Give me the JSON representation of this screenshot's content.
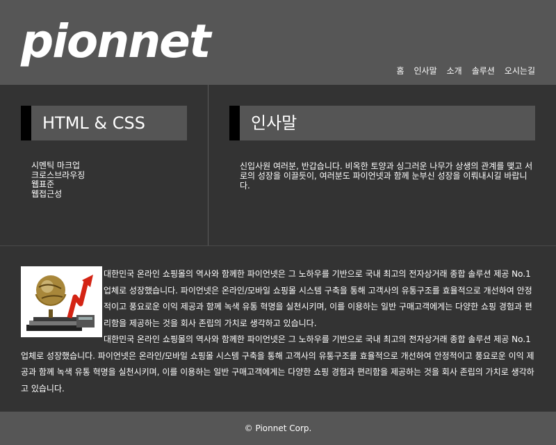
{
  "header": {
    "logo": "pionnet",
    "nav": [
      "홈",
      "인사말",
      "소개",
      "솔루션",
      "오시는길"
    ]
  },
  "left": {
    "title": "HTML & CSS",
    "items": [
      "시멘틱 마크업",
      "크로스브라우징",
      "웹표준",
      "웹접근성"
    ]
  },
  "right": {
    "title": "인사말",
    "text": "신입사원 여러분, 반갑습니다. 비옥한 토양과 싱그러운 나무가 상생의 관계를 맺고 서로의 성장을 이끌듯이, 여러분도 파이언넷과 함께 눈부신 성장을 이뤄내시길 바랍니다."
  },
  "content": {
    "image_icon": "globe-arrow-graph-icon",
    "paragraph_1": "대한민국 온라인 쇼핑몰의 역사와 함께한 파이언넷은 그 노하우를 기반으로 국내 최고의 전자상거래 종합 솔루션 제공 No.1 업체로 성장했습니다. 파이언넷은 온라인/모바일 쇼핑몰 시스템 구축을 통해 고객사의 유통구조를 효율적으로 개선하여 안정적이고 풍요로운 이익 제공과 함께 녹색 유통 혁명을 실천시키며, 이를 이용하는 일반 구매고객에게는 다양한 쇼핑 경험과 편리함을 제공하는 것을 회사 존립의 가치로 생각하고 있습니다.",
    "paragraph_2": "대한민국 온라인 쇼핑몰의 역사와 함께한 파이언넷은 그 노하우를 기반으로 국내 최고의 전자상거래 종합 솔루션 제공 No.1 업체로 성장했습니다. 파이언넷은 온라인/모바일 쇼핑몰 시스템 구축을 통해 고객사의 유통구조를 효율적으로 개선하여 안정적이고 풍요로운 이익 제공과 함께 녹색 유통 혁명을 실천시키며, 이를 이용하는 일반 구매고객에게는 다양한 쇼핑 경험과 편리함을 제공하는 것을 회사 존립의 가치로 생각하고 있습니다."
  },
  "footer": {
    "copyright": "© Pionnet Corp."
  },
  "colors": {
    "header_bg": "#565656",
    "body_bg": "#333333",
    "title_bg": "#555555",
    "title_bar": "#000000",
    "footer_bg": "#565656"
  }
}
